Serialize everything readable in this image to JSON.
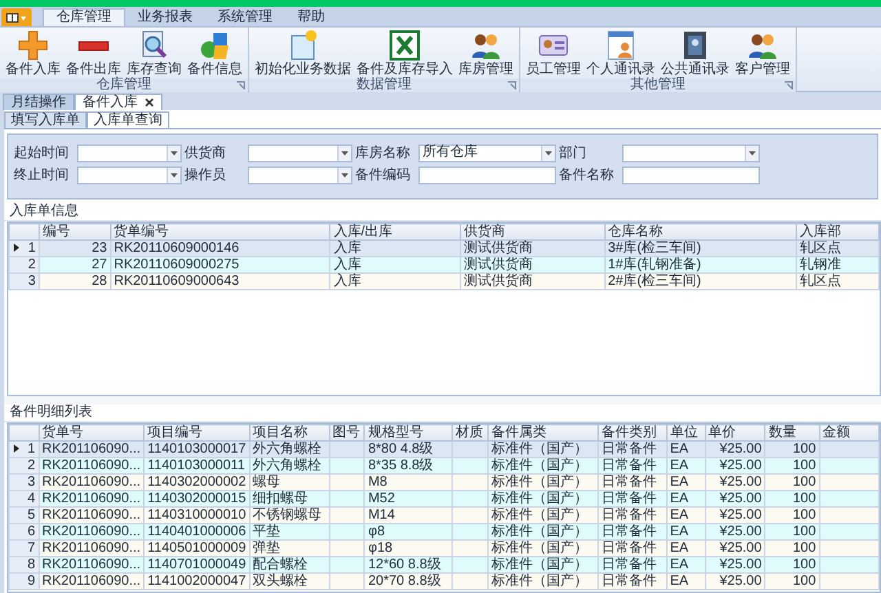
{
  "ribbon_tabs": [
    {
      "label": "仓库管理",
      "selected": true
    },
    {
      "label": "业务报表",
      "selected": false
    },
    {
      "label": "系统管理",
      "selected": false
    },
    {
      "label": "帮助",
      "selected": false
    }
  ],
  "ribbon_groups": [
    {
      "title": "仓库管理",
      "buttons": [
        {
          "label": "备件入库",
          "kind": "plus"
        },
        {
          "label": "备件出库",
          "kind": "minus"
        },
        {
          "label": "库存查询",
          "kind": "magnifier"
        },
        {
          "label": "备件信息",
          "kind": "cubes"
        }
      ]
    },
    {
      "title": "数据管理",
      "buttons": [
        {
          "label": "初始化业务数据",
          "kind": "document"
        },
        {
          "label": "备件及库存导入",
          "kind": "spreadsheet"
        },
        {
          "label": "库房管理",
          "kind": "people"
        }
      ]
    },
    {
      "title": "其他管理",
      "buttons": [
        {
          "label": "员工管理",
          "kind": "card"
        },
        {
          "label": "个人通讯录",
          "kind": "contact"
        },
        {
          "label": "公共通讯录",
          "kind": "book"
        },
        {
          "label": "客户管理",
          "kind": "people"
        }
      ]
    }
  ],
  "doc_tabs": [
    {
      "label": "月结操作",
      "selected": false,
      "closable": false
    },
    {
      "label": "备件入库",
      "selected": true,
      "closable": true
    }
  ],
  "sub_tabs": [
    {
      "label": "填写入库单",
      "selected": false
    },
    {
      "label": "入库单查询",
      "selected": true
    }
  ],
  "filters": [
    {
      "label": "起始时间",
      "kind": "combo"
    },
    {
      "label": "供货商",
      "kind": "combo"
    },
    {
      "label": "库房名称",
      "kind": "combo",
      "value": "所有仓库"
    },
    {
      "label": "部门",
      "kind": "combo"
    },
    {
      "label": "终止时间",
      "kind": "combo"
    },
    {
      "label": "操作员",
      "kind": "combo"
    },
    {
      "label": "备件编码",
      "kind": "text"
    },
    {
      "label": "备件名称",
      "kind": "text"
    }
  ],
  "receipts": {
    "title": "入库单信息",
    "columns": [
      {
        "kind": "number"
      },
      {
        "label": "编号",
        "kind": "number"
      },
      {
        "label": "货单编号",
        "kind": "text"
      },
      {
        "label": "入库/出库",
        "kind": "text"
      },
      {
        "label": "供货商",
        "kind": "text"
      },
      {
        "label": "仓库名称",
        "kind": "text"
      },
      {
        "label": "入库部",
        "kind": "text"
      }
    ],
    "rows": [
      {
        "selected": true,
        "cells": [
          "1",
          "23",
          "RK20110609000146",
          "入库",
          "测试供货商",
          "3#库(检三车间)",
          "轧区点"
        ]
      },
      {
        "selected": false,
        "cells": [
          "2",
          "27",
          "RK20110609000275",
          "入库",
          "测试供货商",
          "1#库(轧钢准备)",
          "轧钢准"
        ]
      },
      {
        "selected": false,
        "cells": [
          "3",
          "28",
          "RK20110609000643",
          "入库",
          "测试供货商",
          "2#库(检三车间)",
          "轧区点"
        ]
      }
    ]
  },
  "details": {
    "title": "备件明细列表",
    "columns": [
      {
        "kind": "number"
      },
      {
        "label": "货单号",
        "kind": "text"
      },
      {
        "label": "项目编号",
        "kind": "text"
      },
      {
        "label": "项目名称",
        "kind": "text"
      },
      {
        "label": "图号",
        "kind": "text"
      },
      {
        "label": "规格型号",
        "kind": "text"
      },
      {
        "label": "材质",
        "kind": "text"
      },
      {
        "label": "备件属类",
        "kind": "text"
      },
      {
        "label": "备件类别",
        "kind": "text"
      },
      {
        "label": "单位",
        "kind": "text"
      },
      {
        "label": "单价",
        "kind": "number"
      },
      {
        "label": "数量",
        "kind": "number"
      },
      {
        "label": "金额",
        "kind": "text"
      }
    ],
    "rows": [
      {
        "selected": true,
        "cells": [
          "1",
          "RK201106090...",
          "1140103000017",
          "外六角螺栓",
          null,
          "8*80  4.8级",
          null,
          "标准件（国产）",
          "日常备件",
          "EA",
          "¥25.00",
          "100",
          null
        ]
      },
      {
        "selected": false,
        "cells": [
          "2",
          "RK201106090...",
          "1140103000011",
          "外六角螺栓",
          null,
          "8*35  8.8级",
          null,
          "标准件（国产）",
          "日常备件",
          "EA",
          "¥25.00",
          "100",
          null
        ]
      },
      {
        "selected": false,
        "cells": [
          "3",
          "RK201106090...",
          "1140302000002",
          "螺母",
          null,
          "M8",
          null,
          "标准件（国产）",
          "日常备件",
          "EA",
          "¥25.00",
          "100",
          null
        ]
      },
      {
        "selected": false,
        "cells": [
          "4",
          "RK201106090...",
          "1140302000015",
          "细扣螺母",
          null,
          "M52",
          null,
          "标准件（国产）",
          "日常备件",
          "EA",
          "¥25.00",
          "100",
          null
        ]
      },
      {
        "selected": false,
        "cells": [
          "5",
          "RK201106090...",
          "1140310000010",
          "不锈钢螺母",
          null,
          "M14",
          null,
          "标准件（国产）",
          "日常备件",
          "EA",
          "¥25.00",
          "100",
          null
        ]
      },
      {
        "selected": false,
        "cells": [
          "6",
          "RK201106090...",
          "1140401000006",
          "平垫",
          null,
          "φ8",
          null,
          "标准件（国产）",
          "日常备件",
          "EA",
          "¥25.00",
          "100",
          null
        ]
      },
      {
        "selected": false,
        "cells": [
          "7",
          "RK201106090...",
          "1140501000009",
          "弹垫",
          null,
          "φ18",
          null,
          "标准件（国产）",
          "日常备件",
          "EA",
          "¥25.00",
          "100",
          null
        ]
      },
      {
        "selected": false,
        "cells": [
          "8",
          "RK201106090...",
          "1140701000049",
          "配合螺栓",
          null,
          "12*60  8.8级",
          null,
          "标准件（国产）",
          "日常备件",
          "EA",
          "¥25.00",
          "100",
          null
        ]
      },
      {
        "selected": false,
        "cells": [
          "9",
          "RK201106090...",
          "1141002000047",
          "双头螺栓",
          null,
          "20*70  8.8级",
          null,
          "标准件（国产）",
          "日常备件",
          "EA",
          "¥25.00",
          "100",
          null
        ]
      }
    ]
  }
}
